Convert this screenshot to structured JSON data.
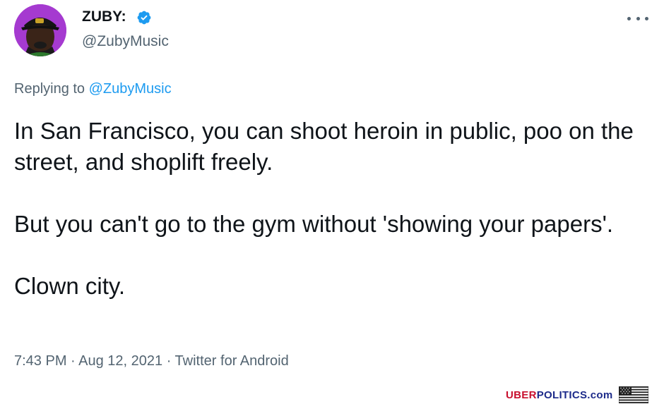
{
  "tweet": {
    "author": {
      "display_name": "ZUBY:",
      "handle": "@ZubyMusic",
      "verified": true,
      "avatar_background": "#a53ad0"
    },
    "replying_to": {
      "prefix": "Replying to",
      "mention": "@ZubyMusic"
    },
    "text_paragraphs": [
      "In San Francisco, you can shoot heroin in public, poo on the street, and shoplift freely.",
      "But you can't go to the gym without 'showing your papers'.",
      "Clown city."
    ],
    "meta": "7:43 PM · Aug 12, 2021 · Twitter for Android"
  },
  "icons": {
    "verified": "verified-badge-icon",
    "more": "more-options-icon",
    "flag": "us-flag-icon"
  },
  "watermark": {
    "part1": "UBER",
    "part2": "POLITICS",
    "part3": ".com"
  },
  "colors": {
    "link": "#1d9bf0",
    "secondary_text": "#536471",
    "primary_text": "#0f1419",
    "watermark_red": "#c8102e",
    "watermark_blue": "#1d2b8a"
  }
}
